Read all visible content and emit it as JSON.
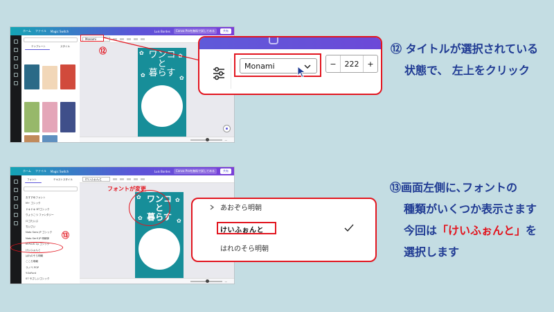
{
  "top_screenshot": {
    "menu_home": "ホーム",
    "menu_file": "ファイル",
    "menu_resize": "Magic Switch",
    "menu_user": "Luis Bordes",
    "menu_trial": "Canva Proを無料で試してみる",
    "share_label": "共有",
    "panel_tabs": [
      "テンプレート",
      "スタイル"
    ],
    "font_name": "Monami",
    "poster_title": "ワンコ\nと\n暮らす",
    "marker": "⑫"
  },
  "zoom_top": {
    "font_select_value": "Monami",
    "font_size_value": "222",
    "minus_label": "−",
    "plus_label": "+"
  },
  "instruction_12": {
    "line1": "⑫ タイトルが選択されている",
    "line2": "状態で、 左上をクリック"
  },
  "bottom_screenshot": {
    "menu_home": "ホーム",
    "menu_file": "ファイル",
    "menu_resize": "Magic Switch",
    "menu_user": "Luis Bordes",
    "menu_trial": "Canva Proを無料で試してみる",
    "share_label": "共有",
    "panel_tabs": [
      "フォント",
      "テキストスタイル"
    ],
    "font_name": "けいふぉんと",
    "annotation": "フォントが変更",
    "poster_title": "ワンコ\nと\n暮らす",
    "marker": "⑬",
    "font_items": [
      "おすすめフォント",
      "M+ ゴシック",
      "ドキドキ BTゴシック",
      "りょうこつ ファンタジー",
      "ロゴたいぷ",
      "ちいさい",
      "Noto Sans JP ゴシック",
      "Noto Serif JP 明朝体",
      "M PLUS 1p ゴシック",
      "けいふぉんと",
      "はれのそら明朝",
      "こころ明朝",
      "ラノベ POP",
      "Y.OzFont",
      "07 やさしいゴシック"
    ]
  },
  "zoom_bottom": {
    "item_above": "あおぞら明朝",
    "item_selected": "けいふぉんと",
    "item_below": "はれのそら明朝"
  },
  "instruction_13": {
    "line1": "⑬画面左側に､フォントの",
    "line2": "種類がいくつか表示さます",
    "line3_pre": "今回は",
    "line3_red": "「けいふぉんと」",
    "line3_post": "を",
    "line4": "選択します"
  },
  "colors": {
    "accent_red": "#e2141e",
    "instruction_blue": "#1f3a93",
    "poster_teal": "#178e99",
    "canva_purple": "#5b55d8"
  }
}
